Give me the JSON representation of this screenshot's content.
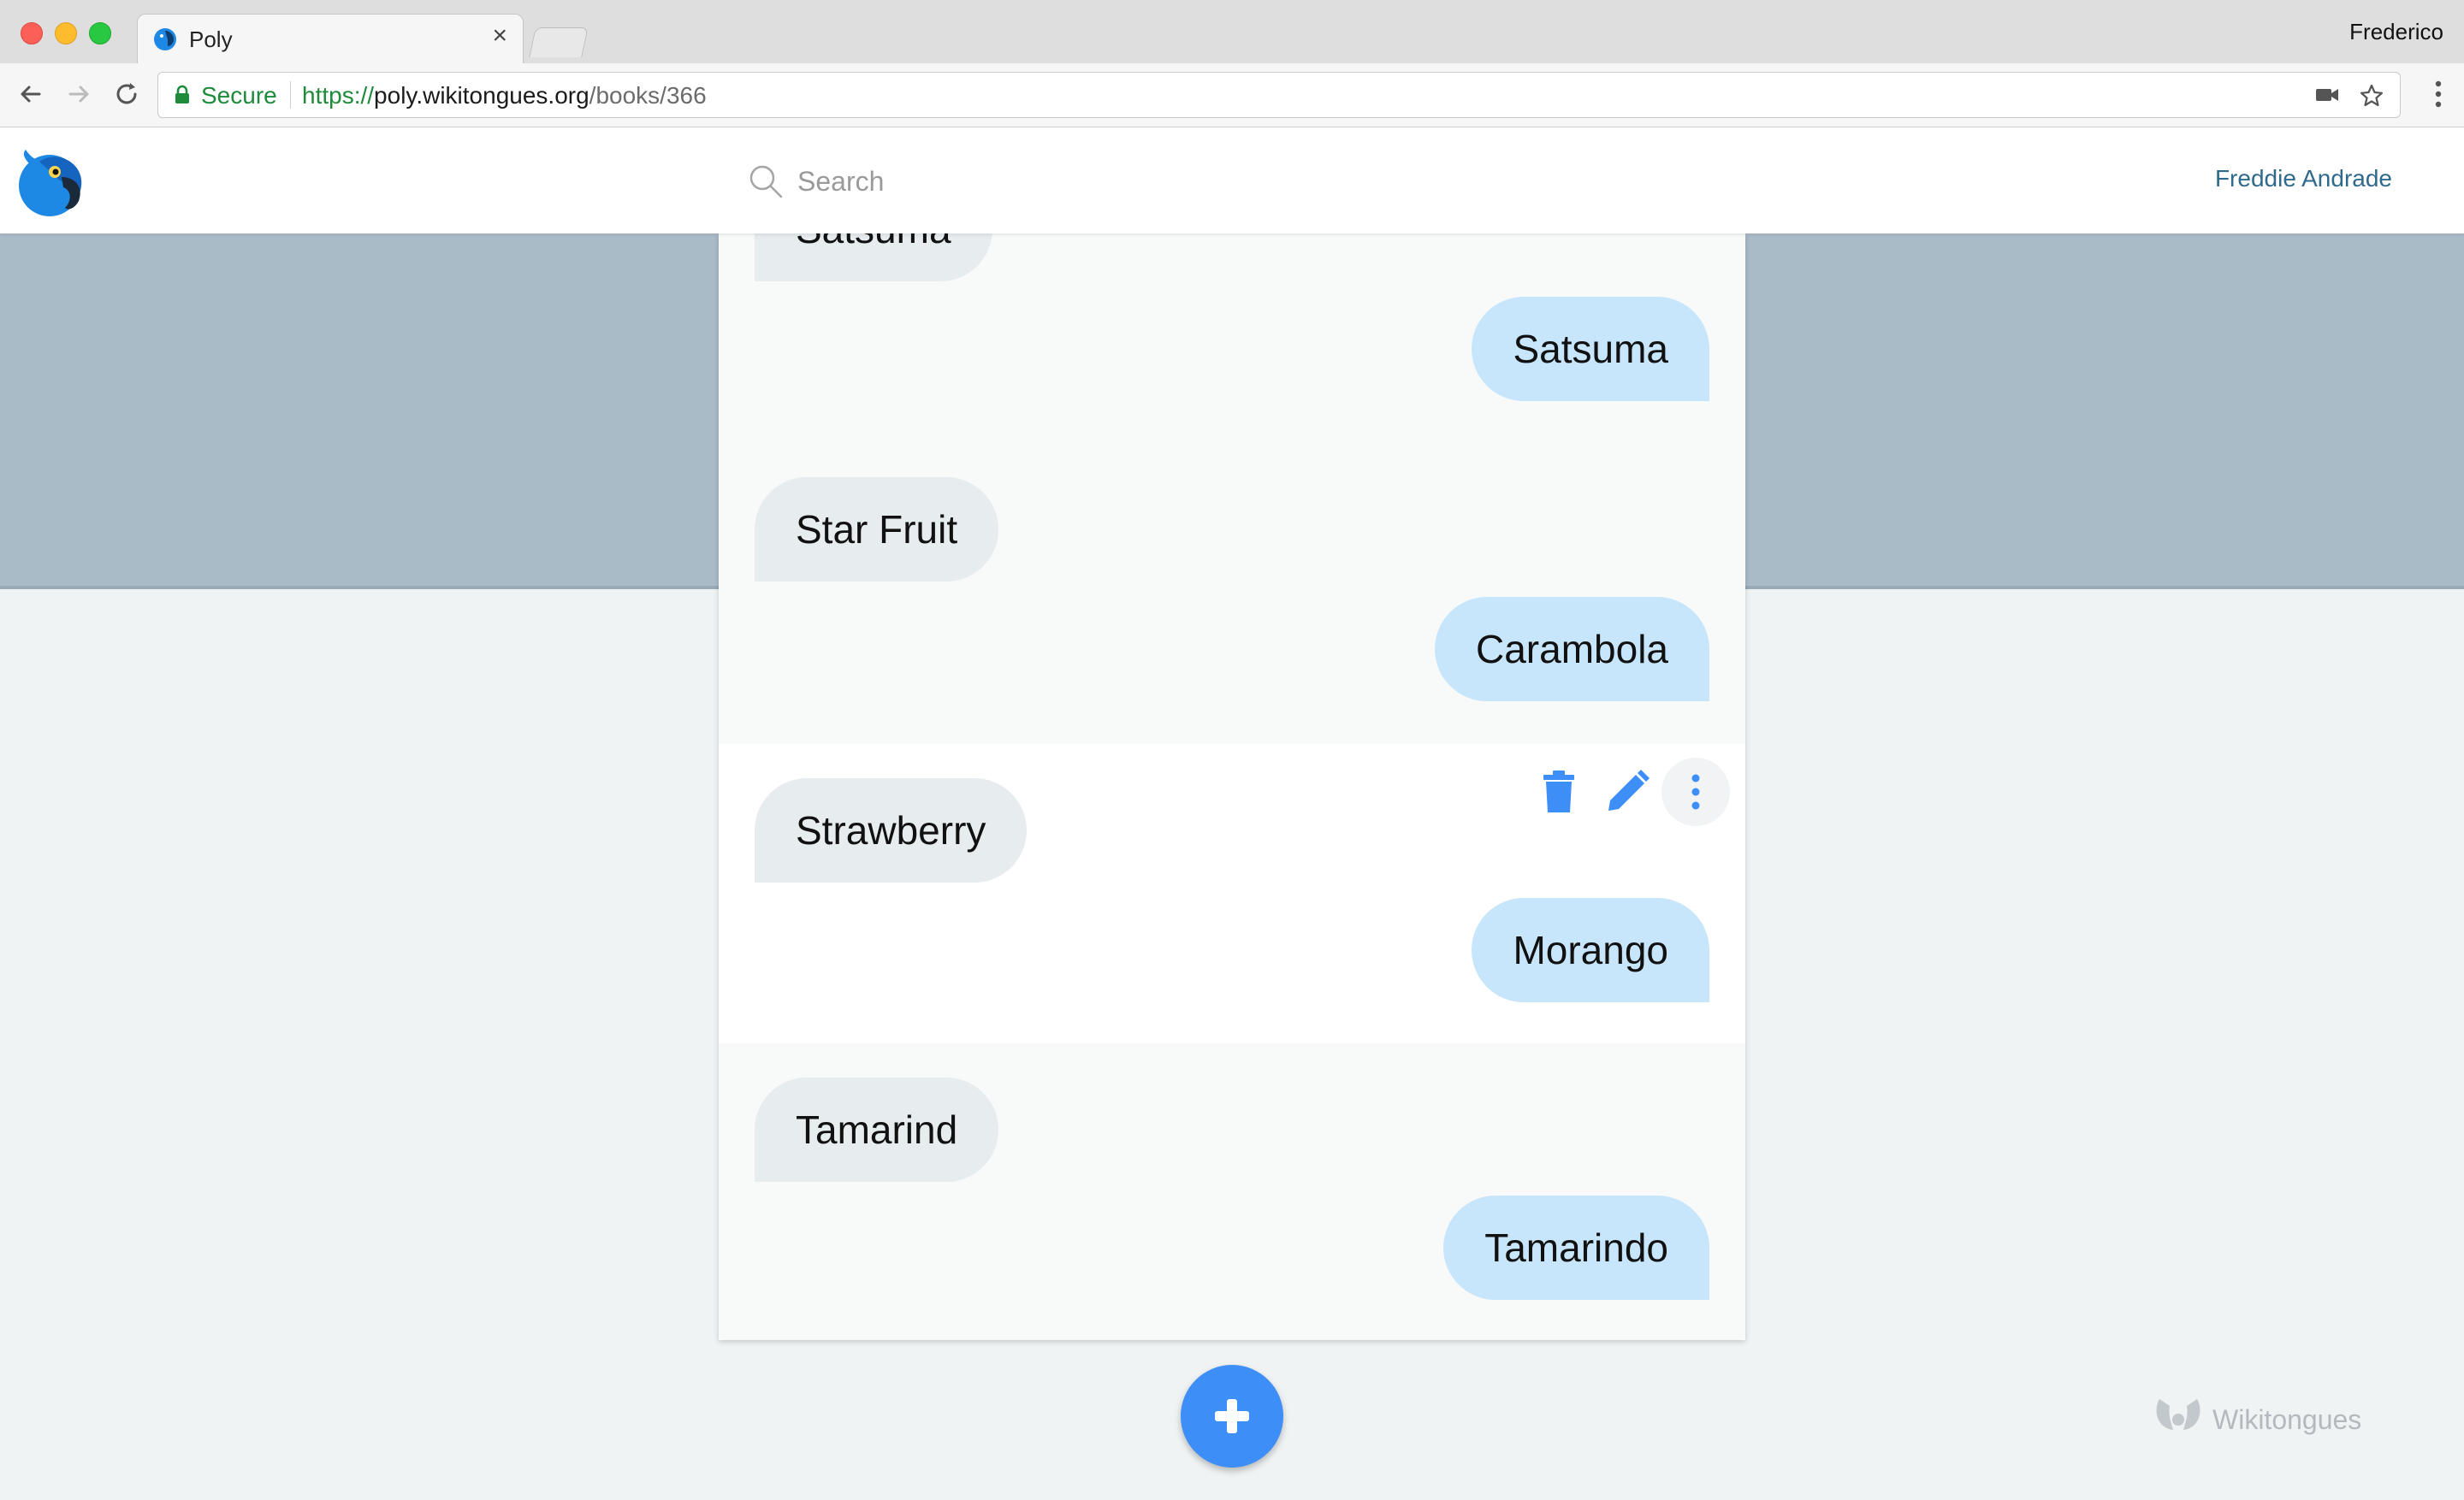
{
  "browser": {
    "tab_title": "Poly",
    "profile_name": "Frederico",
    "secure_label": "Secure",
    "url_scheme": "https://",
    "url_host": "poly.wikitongues.org",
    "url_path": "/books/366"
  },
  "header": {
    "search_placeholder": "Search",
    "user_name": "Freddie Andrade"
  },
  "entries": [
    {
      "source": "Satsuma",
      "translation": "Satsuma"
    },
    {
      "source": "Star Fruit",
      "translation": "Carambola"
    },
    {
      "source": "Strawberry",
      "translation": "Morango"
    },
    {
      "source": "Tamarind",
      "translation": "Tamarindo"
    }
  ],
  "actions": {
    "delete_icon": "trash-icon",
    "edit_icon": "pencil-icon",
    "more_icon": "more-vert-icon"
  },
  "footer": {
    "brand": "Wikitongues"
  },
  "colors": {
    "accent": "#3d8ef7",
    "banner": "#aabbc8",
    "source_bubble": "#e7ecef",
    "translation_bubble": "#c8e6fb",
    "link": "#2f6a8c"
  }
}
